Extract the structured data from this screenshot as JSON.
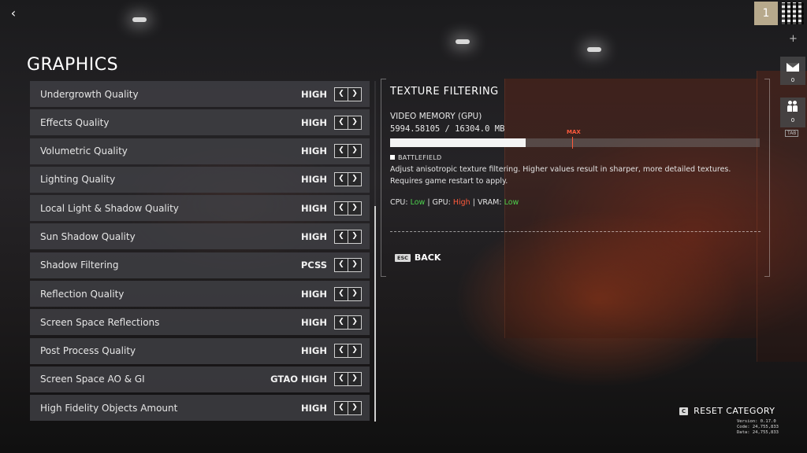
{
  "header": {
    "back_icon": "chevron-left-icon",
    "back_glyph": "‹"
  },
  "page": {
    "title": "GRAPHICS"
  },
  "settings": [
    {
      "label": "Undergrowth Quality",
      "value": "HIGH"
    },
    {
      "label": "Effects Quality",
      "value": "HIGH"
    },
    {
      "label": "Volumetric Quality",
      "value": "HIGH"
    },
    {
      "label": "Lighting Quality",
      "value": "HIGH"
    },
    {
      "label": "Local Light & Shadow Quality",
      "value": "HIGH"
    },
    {
      "label": "Sun Shadow Quality",
      "value": "HIGH"
    },
    {
      "label": "Shadow Filtering",
      "value": "PCSS"
    },
    {
      "label": "Reflection Quality",
      "value": "HIGH"
    },
    {
      "label": "Screen Space Reflections",
      "value": "HIGH"
    },
    {
      "label": "Post Process Quality",
      "value": "HIGH"
    },
    {
      "label": "Screen Space AO & GI",
      "value": "GTAO HIGH"
    },
    {
      "label": "High Fidelity Objects Amount",
      "value": "HIGH"
    }
  ],
  "arrows": {
    "prev": "❮",
    "next": "❯"
  },
  "info": {
    "title": "TEXTURE FILTERING",
    "vram_label": "VIDEO MEMORY (GPU)",
    "vram_value": "5994.58105 / 16304.0 MB",
    "vram_used_fraction": 0.3677,
    "max_label": "MAX",
    "max_fraction": 0.493,
    "game_tag": "BATTLEFIELD",
    "description": "Adjust anisotropic texture filtering. Higher values result in sharper, more detailed textures. Requires game restart to apply.",
    "cpu_label": "CPU:",
    "cpu_value": "Low",
    "gpu_label": "GPU:",
    "gpu_value": "High",
    "vram_impact_label": "VRAM:",
    "vram_impact_value": "Low",
    "separator": "|",
    "back_key": "ESC",
    "back_label": "BACK"
  },
  "sidebar": {
    "rank": "1",
    "mail_count": "0",
    "friends_count": "0",
    "tab_key": "TAB",
    "plus": "+"
  },
  "footer": {
    "reset_key": "C",
    "reset_label": "RESET CATEGORY",
    "version": "Version: 0.17.0",
    "code": "Code: 24,755,833",
    "date": "Data: 24,755,833"
  },
  "colors": {
    "low": "#4cd04c",
    "high": "#ff5a3c",
    "row_bg": "#404044"
  }
}
